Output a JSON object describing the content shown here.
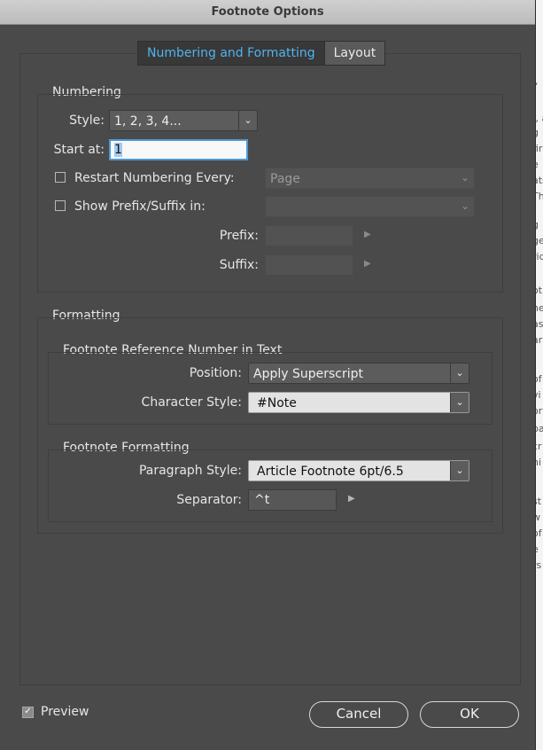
{
  "window": {
    "title": "Footnote Options"
  },
  "tabs": [
    {
      "label": "Numbering and Formatting",
      "active": true
    },
    {
      "label": "Layout",
      "active": false
    }
  ],
  "numbering": {
    "section_title": "Numbering",
    "style_label": "Style:",
    "style_value": "1, 2, 3, 4...",
    "start_label": "Start at:",
    "start_value": "1",
    "restart_label": "Restart Numbering Every:",
    "restart_checked": false,
    "restart_value": "Page",
    "prefix_suffix_label": "Show Prefix/Suffix in:",
    "prefix_suffix_checked": false,
    "prefix_suffix_value": "",
    "prefix_label": "Prefix:",
    "prefix_value": "",
    "suffix_label": "Suffix:",
    "suffix_value": ""
  },
  "formatting": {
    "section_title": "Formatting",
    "reference": {
      "title": "Footnote Reference Number in Text",
      "position_label": "Position:",
      "position_value": "Apply Superscript",
      "char_style_label": "Character Style:",
      "char_style_value": "#Note"
    },
    "footnote": {
      "title": "Footnote Formatting",
      "para_style_label": "Paragraph Style:",
      "para_style_value": "Article Footnote 6pt/6.5",
      "separator_label": "Separator:",
      "separator_value": "^t"
    }
  },
  "footer": {
    "preview_label": "Preview",
    "preview_checked": true,
    "cancel_label": "Cancel",
    "ok_label": "OK"
  },
  "background_doc_fragments": [
    "l,",
    "., a",
    "g",
    "fir",
    "e",
    "ats",
    "Th",
    "g",
    "ge",
    "rid",
    "ot",
    "he",
    "as",
    "ar",
    "of",
    "vi",
    "or",
    "ba",
    "cr",
    "hi",
    "st",
    "w",
    "of",
    "e",
    "rs"
  ],
  "colors": {
    "accent": "#4fb3f0",
    "dialog_bg": "#4a4a4a"
  }
}
